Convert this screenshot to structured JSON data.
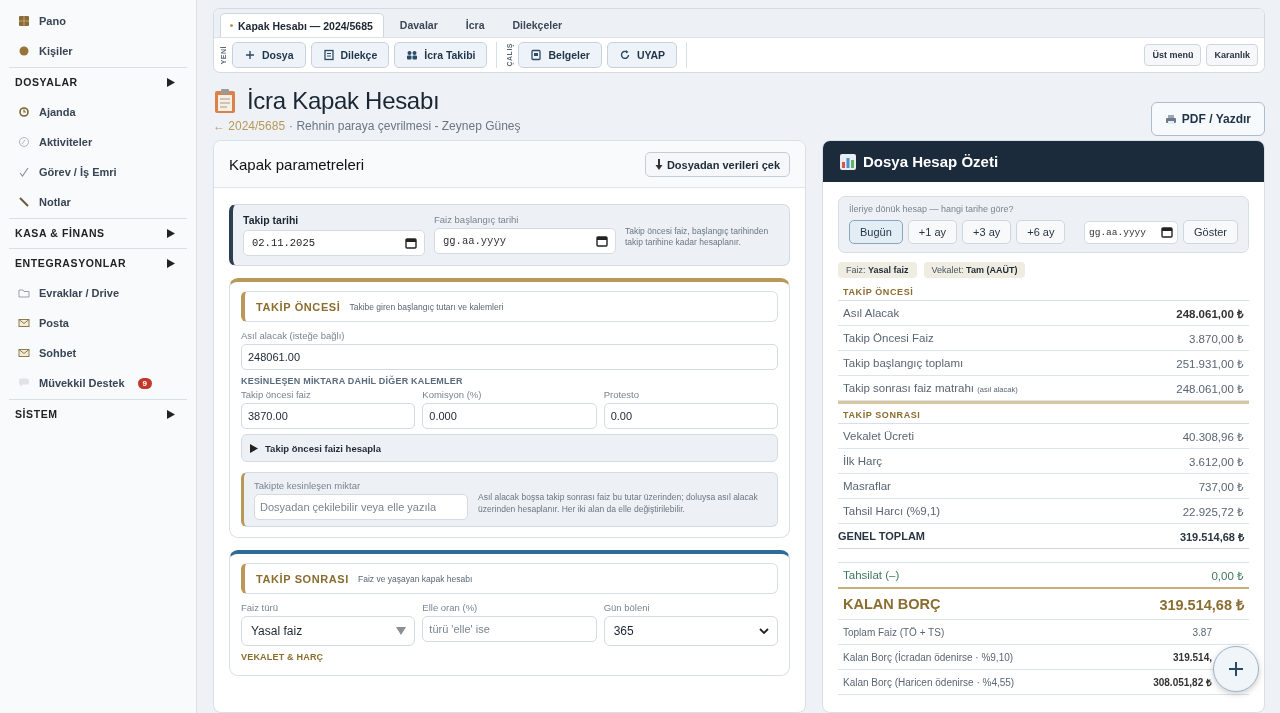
{
  "sidebar": {
    "items": [
      {
        "kind": "link",
        "label": "Pano"
      },
      {
        "kind": "link",
        "label": "Kişiler"
      },
      {
        "kind": "section",
        "label": "DOSYALAR"
      },
      {
        "kind": "link",
        "label": "Ajanda"
      },
      {
        "kind": "link",
        "label": "Aktiviteler"
      },
      {
        "kind": "link",
        "label": "Görev / İş Emri"
      },
      {
        "kind": "link",
        "label": "Notlar"
      },
      {
        "kind": "section",
        "label": "KASA & FİNANS"
      },
      {
        "kind": "section",
        "label": "ENTEGRASYONLAR"
      },
      {
        "kind": "link",
        "label": "Evraklar / Drive"
      },
      {
        "kind": "link",
        "label": "Posta"
      },
      {
        "kind": "link",
        "label": "Sohbet"
      },
      {
        "kind": "link",
        "label": "Müvekkil Destek",
        "badge": "9"
      },
      {
        "kind": "section",
        "label": "SİSTEM"
      }
    ]
  },
  "toolbar": {
    "tabs": [
      {
        "label": "Kapak Hesabı — 2024/5685",
        "selected": true
      },
      {
        "label": "Davalar",
        "selected": false
      },
      {
        "label": "İcra",
        "selected": false
      },
      {
        "label": "Dilekçeler",
        "selected": false
      }
    ],
    "groups": [
      {
        "label": "YENİ",
        "buttons": [
          "Dosya",
          "Dilekçe",
          "İcra Takibi"
        ]
      },
      {
        "label": "ÇALIŞ",
        "buttons": [
          "Belgeler",
          "UYAP"
        ]
      }
    ],
    "right_buttons": [
      "Üst menü",
      "Karanlık"
    ]
  },
  "header": {
    "title": "İcra Kapak Hesabı",
    "back_link": "← 2024/5685",
    "subtitle": "· Rehnin paraya çevrilmesi - Zeynep Güneş",
    "print_button": "PDF / Yazdır"
  },
  "parameters": {
    "title": "Kapak parametreleri",
    "fetch_button": "Dosyadan verileri çek",
    "dates": {
      "fields": [
        {
          "label": "Takip tarihi",
          "value": "02.11.2025"
        },
        {
          "label": "Faiz başlangıç tarihi",
          "placeholder": "gg.aa.yyyy"
        }
      ],
      "note": "Takip öncesi faiz, başlangıç tarihinden takip tarihine kadar hesaplanır."
    },
    "sections": [
      {
        "title": "TAKİP ÖNCESİ",
        "subtitle": "Takibe giren başlangıç tutarı ve kalemleri",
        "color": "#b8995a",
        "blocks": [
          {
            "kind": "fields",
            "fields": [
              {
                "kind": "text",
                "label": "Asıl alacak (isteğe bağlı)",
                "value": "248061.00"
              }
            ]
          },
          {
            "kind": "subheading",
            "text": "KESİNLEŞEN MİKTARA DAHİL DİĞER KALEMLER",
            "color": "#5b6b7e"
          },
          {
            "kind": "fields",
            "fields": [
              {
                "kind": "text",
                "label": "Takip öncesi faiz",
                "value": "3870.00"
              },
              {
                "kind": "text",
                "label": "Komisyon (%)",
                "value": "0.000"
              },
              {
                "kind": "text",
                "label": "Protesto",
                "value": "0.00"
              }
            ]
          },
          {
            "kind": "disclosure",
            "label": "Takip öncesi faizi hesapla",
            "expanded": false
          },
          {
            "kind": "callout",
            "field": {
              "label": "Takipte kesinleşen miktar",
              "placeholder": "Dosyadan çekilebilir veya elle yazıla"
            },
            "note": "Asıl alacak boşsa takip sonrası faiz bu tutar üzerinden; doluysa asıl alacak üzerinden hesaplanır. Her iki alan da elle değiştirilebilir."
          }
        ]
      },
      {
        "title": "TAKİP SONRASI",
        "subtitle": "Faiz ve yaşayan kapak hesabı",
        "color": "#2f6b98",
        "blocks": [
          {
            "kind": "fields",
            "fields": [
              {
                "kind": "dropdown",
                "label": "Faiz türü",
                "value": "Yasal faiz"
              },
              {
                "kind": "text",
                "label": "Elle oran (%)",
                "placeholder": "türü 'elle' ise"
              },
              {
                "kind": "select",
                "label": "Gün böleni",
                "value": "365"
              }
            ]
          },
          {
            "kind": "subheading",
            "text": "VEKALET & HARÇ",
            "color": "#8a6d2f"
          }
        ]
      }
    ]
  },
  "summary": {
    "title": "Dosya Hesap Özeti",
    "forecast": {
      "label": "İleriye dönük hesap — hangi tarihe göre?",
      "options": [
        {
          "label": "Bugün",
          "selected": true
        },
        {
          "label": "+1 ay",
          "selected": false
        },
        {
          "label": "+3 ay",
          "selected": false
        },
        {
          "label": "+6 ay",
          "selected": false
        }
      ],
      "date_placeholder": "gg.aa.yyyy",
      "show_button": "Göster"
    },
    "chips": [
      {
        "key": "Faiz:",
        "value": "Yasal faiz"
      },
      {
        "key": "Vekalet:",
        "value": "Tam (AAÜT)"
      }
    ],
    "rows": [
      {
        "kind": "heading",
        "label": "TAKİP ÖNCESİ"
      },
      {
        "kind": "strong",
        "label": "Asıl Alacak",
        "value": "248.061,00 ₺"
      },
      {
        "kind": "row",
        "label": "Takip Öncesi Faiz",
        "value": "3.870,00 ₺"
      },
      {
        "kind": "row",
        "label": "Takip başlangıç toplamı",
        "value": "251.931,00 ₺"
      },
      {
        "kind": "row",
        "label": "Takip sonrası faiz matrahı",
        "note": "(asıl alacak)",
        "value": "248.061,00 ₺"
      },
      {
        "kind": "heading",
        "label": "TAKİP SONRASI"
      },
      {
        "kind": "row",
        "label": "Vekalet Ücreti",
        "value": "40.308,96 ₺"
      },
      {
        "kind": "row",
        "label": "İlk Harç",
        "value": "3.612,00 ₺"
      },
      {
        "kind": "row",
        "label": "Masraflar",
        "value": "737,00 ₺"
      },
      {
        "kind": "row",
        "label": "Tahsil Harcı (%9,1)",
        "value": "22.925,72 ₺"
      },
      {
        "kind": "total",
        "label": "GENEL TOPLAM",
        "value": "319.514,68 ₺"
      },
      {
        "kind": "collected",
        "label": "Tahsilat (–)",
        "value": "0,00 ₺"
      },
      {
        "kind": "remaining",
        "label": "KALAN BORÇ",
        "value": "319.514,68 ₺"
      },
      {
        "kind": "small",
        "label": "Toplam Faiz (TÖ + TS)",
        "value": "3.87"
      },
      {
        "kind": "small-strong",
        "label": "Kalan Borç (İcradan ödenirse · %9,10)",
        "value": "319.514,"
      },
      {
        "kind": "small-strong",
        "label": "Kalan Borç (Haricen ödenirse · %4,55)",
        "value": "308.051,82 ₺"
      }
    ]
  }
}
